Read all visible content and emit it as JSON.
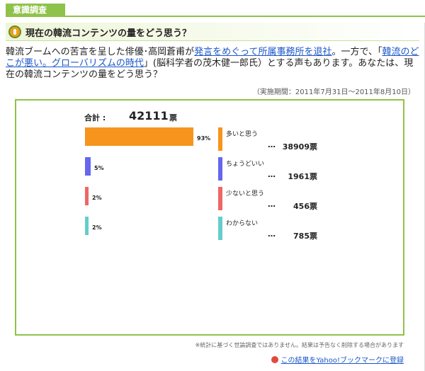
{
  "tab_label": "意識調査",
  "question_title": "現在の韓流コンテンツの量をどう思う？",
  "intro": {
    "t1": "韓流ブームへの苦言を呈した俳優･高岡蒼甫が",
    "link1": "発言をめぐって所属事務所を退社",
    "t2": "。一方で、「",
    "link2": "韓流のどこが悪い。グローバリズムの時代",
    "t3": "」(脳科学者の茂木健一郎氏）とする声もあります。あなたは、現在の韓流コンテンツの量をどう思う？"
  },
  "period": "（実施期間：2011年7月31日〜2011年8月10日）",
  "total": {
    "label": "合計 :",
    "value": "42111",
    "unit": "票"
  },
  "results": [
    {
      "answer": "多いと思う",
      "dots": "…",
      "votes": "38909",
      "unit": "票",
      "percent": "93%",
      "percent_value": 93,
      "color": "#f7941d"
    },
    {
      "answer": "ちょうどいい",
      "dots": "…",
      "votes": "1961",
      "unit": "票",
      "percent": "5%",
      "percent_value": 5,
      "color": "#6666ee"
    },
    {
      "answer": "少ないと思う",
      "dots": "…",
      "votes": "456",
      "unit": "票",
      "percent": "2%",
      "percent_value": 2,
      "color": "#ee6666"
    },
    {
      "answer": "わからない",
      "dots": "…",
      "votes": "785",
      "unit": "票",
      "percent": "2%",
      "percent_value": 2,
      "color": "#66cccc"
    }
  ],
  "note": "※統計に基づく世論調査ではありません。結果は予告なく削除する場合があります",
  "bookmark_link": "この結果をYahoo!ブックマークに登録"
}
